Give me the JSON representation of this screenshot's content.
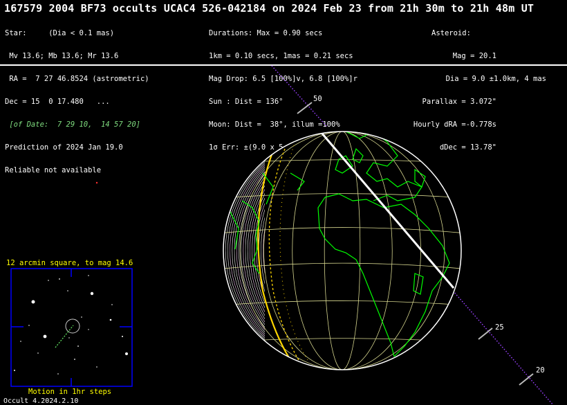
{
  "header": {
    "title": "167579 2004 BF73 occults UCAC4 526-042184 on 2024 Feb 23 from 21h 30m to 21h 48m UT"
  },
  "star_block": [
    "Star:     (Dia < 0.1 mas)",
    " Mv 13.6; Mb 13.6; Mr 13.6",
    " RA =  7 27 46.8524 (astrometric)",
    "Dec = 15  0 17.480   ...",
    " [of Date:  7 29 10,  14 57 20]",
    "Prediction of 2024 Jan 19.0",
    "Reliable not available"
  ],
  "event_block": [
    "Durations: Max = 0.90 secs",
    "1km = 0.10 secs, 1mas = 0.21 secs",
    "Mag Drop: 6.5 [100%]v, 6.8 [100%]r",
    "Sun : Dist = 136°",
    "Moon: Dist =  38°, illum =100%",
    "1σ Err: ±(9.0 x 5.0) mas in PA 84°"
  ],
  "asteroid_block": [
    "Asteroid:",
    "Mag = 20.1",
    "Dia = 9.0 ±1.0km, 4 mas",
    "Parallax = 3.072\"",
    "Hourly dRA =-0.778s",
    "dDec = 13.78\""
  ],
  "path_labels": {
    "top": "50",
    "mid": "25",
    "bottom": "20"
  },
  "star_chart": {
    "title": "12 arcmin square, to mag 14.6",
    "motion_note": "Motion in 1hr steps"
  },
  "footer": {
    "version": "Occult 4.2024.2.10"
  },
  "colors": {
    "background": "#000000",
    "coastline": "#00ff00",
    "grid": "#d8d890",
    "path_center": "#ffffff",
    "path_limits": "#ffd700",
    "track": "#9a40ff",
    "chart_frame": "#0000ff",
    "chart_text": "#ffff00"
  }
}
